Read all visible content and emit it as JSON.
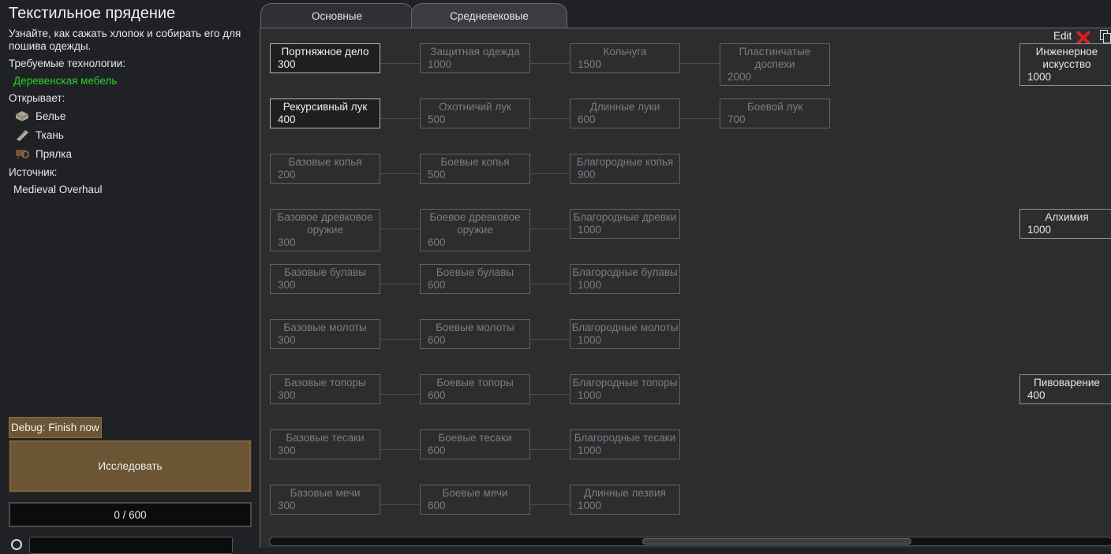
{
  "info": {
    "title": "Текстильное прядение",
    "description": "Узнайте, как сажать хлопок и собирать его для пошива одежды.",
    "required_label": "Требуемые технологии:",
    "required": "Деревенская мебель",
    "unlocks_label": "Открывает:",
    "unlocks": [
      {
        "label": "Белье",
        "icon": "linen-icon"
      },
      {
        "label": "Ткань",
        "icon": "cloth-icon"
      },
      {
        "label": "Прялка",
        "icon": "spinning-wheel-icon"
      }
    ],
    "source_label": "Источник:",
    "source": "Medieval Overhaul"
  },
  "actions": {
    "debug": "Debug: Finish now",
    "research": "Исследовать",
    "progress": "0 / 600",
    "progress_fraction": 0
  },
  "tabs": [
    {
      "label": "Основные",
      "active": false
    },
    {
      "label": "Средневековые",
      "active": true
    }
  ],
  "tree_header": {
    "edit": "Edit"
  },
  "tree": {
    "rows": [
      [
        {
          "name": "Портняжное дело",
          "cost": "300",
          "state": "known"
        },
        {
          "name": "Защитная одежда",
          "cost": "1000"
        },
        {
          "name": "Кольчуга",
          "cost": "1500"
        },
        {
          "name": "Пластинчатые доспехи",
          "cost": "2000"
        }
      ],
      [
        {
          "name": "Рекурсивный лук",
          "cost": "400",
          "state": "known"
        },
        {
          "name": "Охотничий лук",
          "cost": "500"
        },
        {
          "name": "Длинные луки",
          "cost": "600"
        },
        {
          "name": "Боевой лук",
          "cost": "700"
        }
      ],
      [
        {
          "name": "Базовые копья",
          "cost": "200"
        },
        {
          "name": "Боевые копья",
          "cost": "500"
        },
        {
          "name": "Благородные копья",
          "cost": "900"
        }
      ],
      [
        {
          "name": "Базовое древковое оружие",
          "cost": "300"
        },
        {
          "name": "Боевое древковое оружие",
          "cost": "600"
        },
        {
          "name": "Благородные древки",
          "cost": "1000"
        }
      ],
      [
        {
          "name": "Базовые булавы",
          "cost": "300"
        },
        {
          "name": "Боевые булавы",
          "cost": "600"
        },
        {
          "name": "Благородные булавы",
          "cost": "1000"
        }
      ],
      [
        {
          "name": "Базовые молоты",
          "cost": "300"
        },
        {
          "name": "Боевые молоты",
          "cost": "600"
        },
        {
          "name": "Благородные молоты",
          "cost": "1000"
        }
      ],
      [
        {
          "name": "Базовые топоры",
          "cost": "300"
        },
        {
          "name": "Боевые топоры",
          "cost": "600"
        },
        {
          "name": "Благородные топоры",
          "cost": "1000"
        }
      ],
      [
        {
          "name": "Базовые тесаки",
          "cost": "300"
        },
        {
          "name": "Боевые тесаки",
          "cost": "600"
        },
        {
          "name": "Благородные тесаки",
          "cost": "1000"
        }
      ],
      [
        {
          "name": "Базовые мечи",
          "cost": "300"
        },
        {
          "name": "Боевые мечи",
          "cost": "600"
        },
        {
          "name": "Длинные лезвия",
          "cost": "1000"
        }
      ]
    ],
    "side": [
      {
        "name": "Инженерное искусство",
        "cost": "1000",
        "row": 0
      },
      {
        "name": "Алхимия",
        "cost": "1000",
        "row": 3
      },
      {
        "name": "Пивоварение",
        "cost": "400",
        "row": 6
      }
    ]
  },
  "colors": {
    "accent_green": "#28d428",
    "button_brown": "#6b5534",
    "close_red": "#d92020"
  }
}
